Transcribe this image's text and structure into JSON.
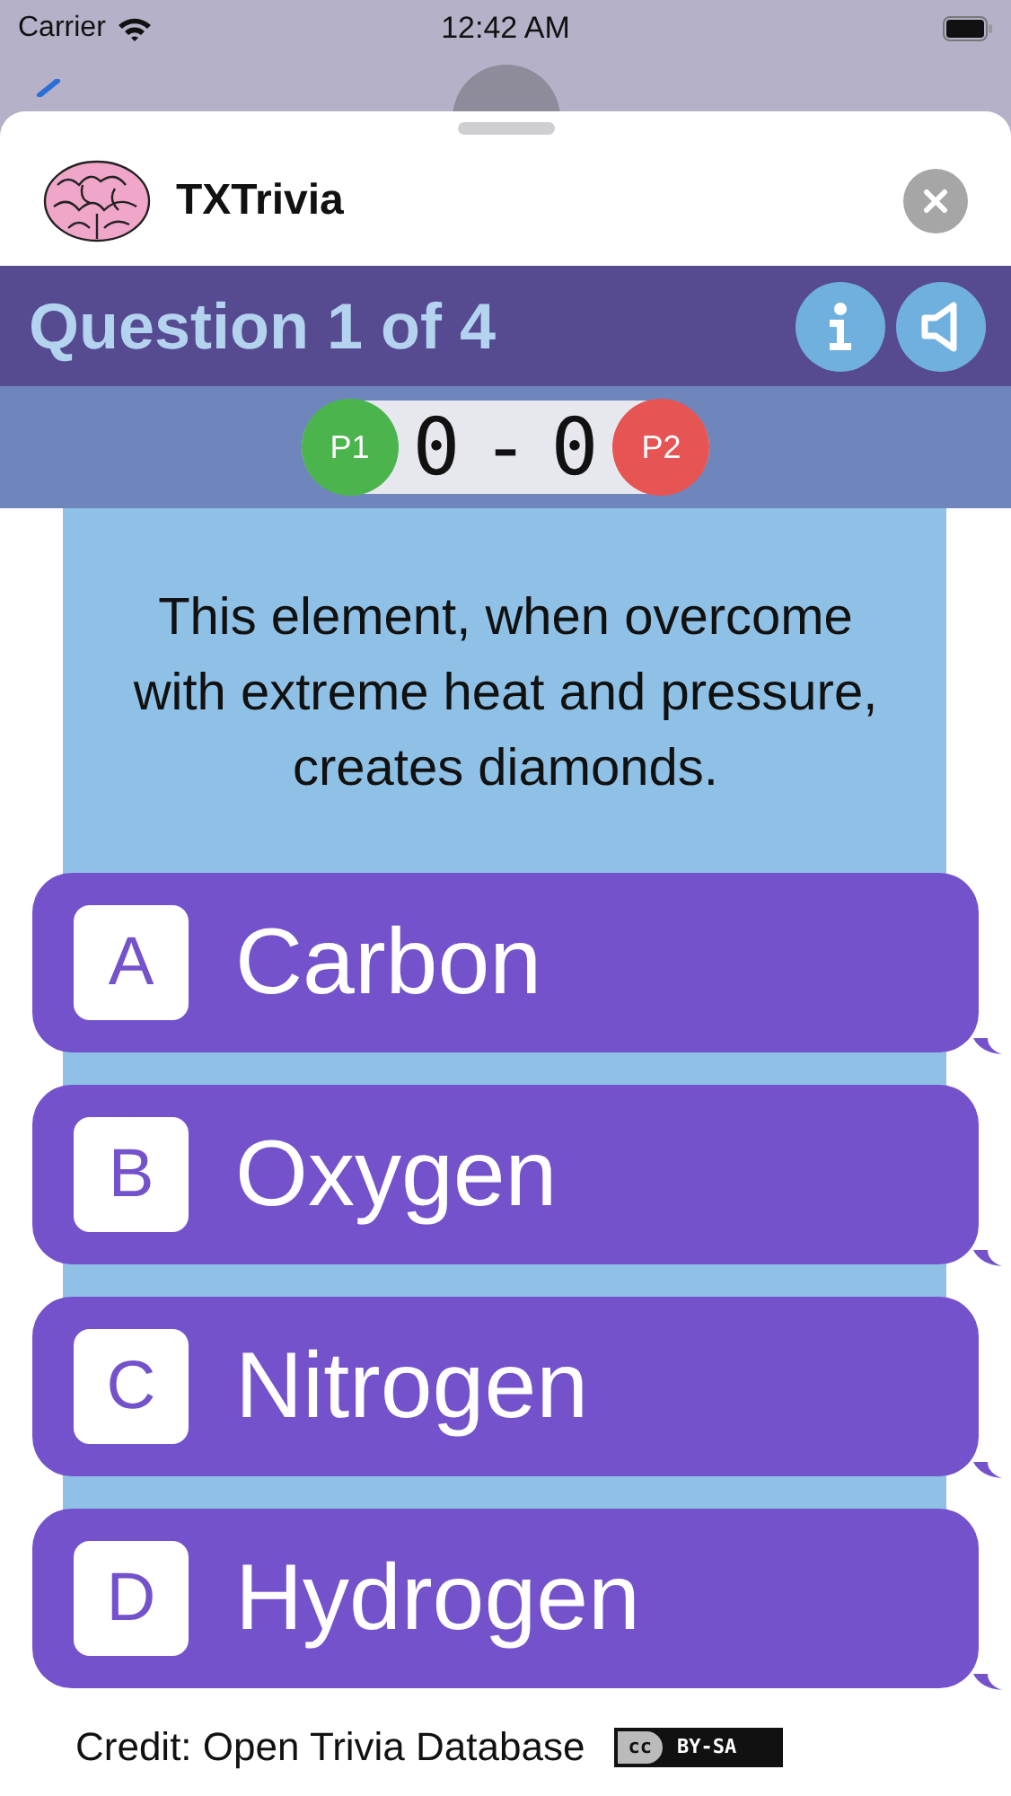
{
  "status_bar": {
    "carrier": "Carrier",
    "time": "12:42 AM"
  },
  "sheet": {
    "title": "TXTrivia"
  },
  "question_bar": {
    "title": "Question 1 of 4"
  },
  "score": {
    "p1_label": "P1",
    "p1_score": "0",
    "separator": "-",
    "p2_score": "0",
    "p2_label": "P2"
  },
  "question": {
    "text": "This element, when overcome with extreme heat and pressure, creates diamonds."
  },
  "answers": [
    {
      "letter": "A",
      "text": "Carbon",
      "selected": false
    },
    {
      "letter": "B",
      "text": "Oxygen",
      "selected": false
    },
    {
      "letter": "C",
      "text": "Nitrogen",
      "selected": false
    },
    {
      "letter": "D",
      "text": "Hydrogen",
      "selected": false
    }
  ],
  "credit": {
    "text": "Credit: Open Trivia Database",
    "license_mark": "cc",
    "license_name": "BY-SA"
  }
}
